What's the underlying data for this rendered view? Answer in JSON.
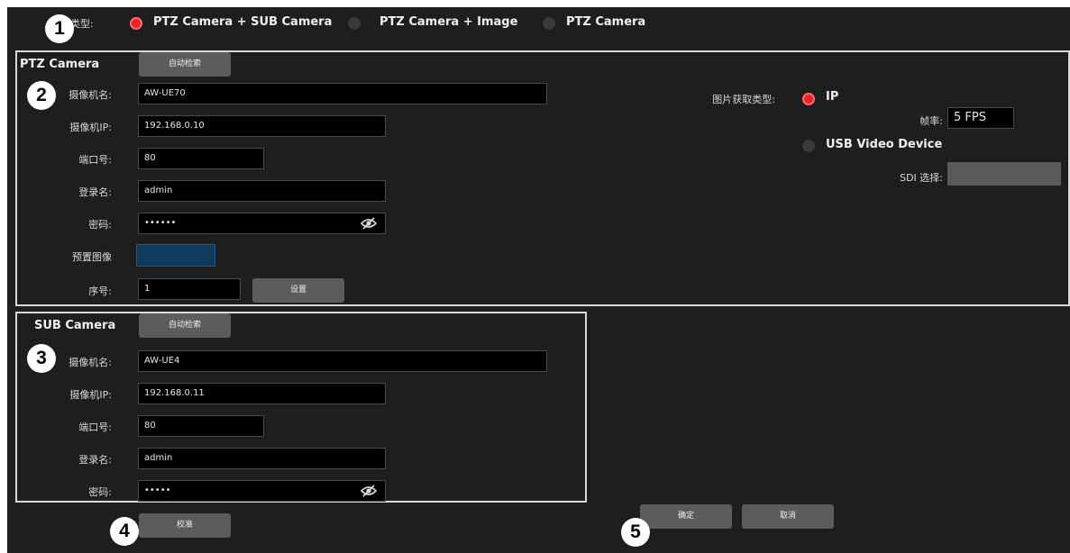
{
  "mode": {
    "label": "类型:",
    "options": [
      {
        "label": "PTZ Camera + SUB Camera",
        "selected": true
      },
      {
        "label": "PTZ Camera + Image",
        "selected": false
      },
      {
        "label": "PTZ Camera",
        "selected": false
      }
    ]
  },
  "badges": [
    "1",
    "2",
    "3",
    "4",
    "5"
  ],
  "ptz": {
    "title": "PTZ Camera",
    "auto_search": "自动检索",
    "name_label": "摄像机名:",
    "name_value": "AW-UE70",
    "ip_label": "摄像机IP:",
    "ip_value": "192.168.0.10",
    "port_label": "端口号:",
    "port_value": "80",
    "user_label": "登录名:",
    "user_value": "admin",
    "pass_label": "密码:",
    "pass_value": "••••••",
    "preset_label": "预置图像",
    "seq_label": "序号:",
    "seq_value": "1",
    "set_button": "设置",
    "image_type_label": "图片获取类型:",
    "ip_option": "IP",
    "fps_label": "帧率:",
    "fps_value": "5 FPS",
    "usb_option": "USB Video Device",
    "sdi_label": "SDI 选择:",
    "sdi_value": ""
  },
  "sub": {
    "title": "SUB Camera",
    "auto_search": "自动检索",
    "name_label": "摄像机名:",
    "name_value": "AW-UE4",
    "ip_label": "摄像机IP:",
    "ip_value": "192.168.0.11",
    "port_label": "端口号:",
    "port_value": "80",
    "user_label": "登录名:",
    "user_value": "admin",
    "pass_label": "密码:",
    "pass_value": "•••••"
  },
  "footer": {
    "calibrate_button": "校准",
    "ok_button": "确定",
    "cancel_button": "取消"
  },
  "colors": {
    "background": "#1e1e1e",
    "radio_selected": "#e8232b",
    "preset_thumb": "#0e3a5c"
  }
}
